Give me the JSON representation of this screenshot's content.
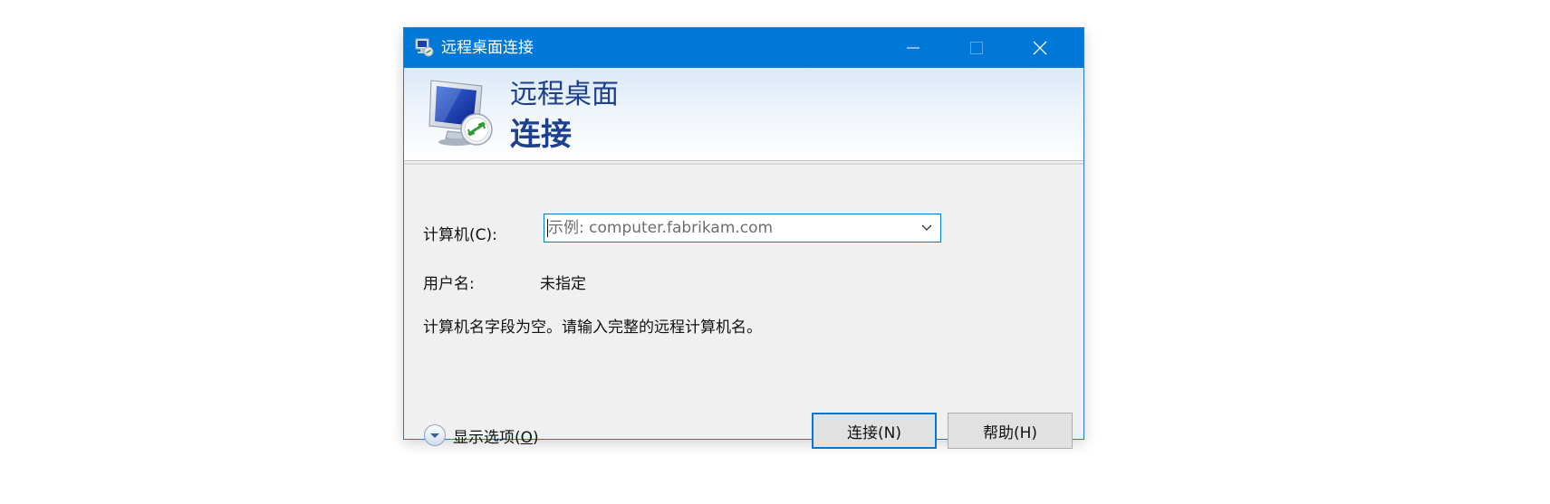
{
  "window": {
    "title": "远程桌面连接",
    "controls": [
      "minimize-icon",
      "maximize-icon",
      "close-icon"
    ]
  },
  "banner": {
    "line1": "远程桌面",
    "line2": "连接"
  },
  "form": {
    "computer_label": "计算机(C):",
    "computer_value": "",
    "computer_placeholder": "示例: computer.fabrikam.com",
    "username_label": "用户名:",
    "username_value": "未指定",
    "message": "计算机名字段为空。请输入完整的远程计算机名。"
  },
  "options": {
    "label_prefix": "显示选项(",
    "mnemonic": "O",
    "label_suffix": ")"
  },
  "buttons": {
    "connect": "连接(N)",
    "help": "帮助(H)"
  },
  "colors": {
    "titlebar": "#0078d7",
    "banner_text": "#1d3f8f",
    "dialog_bg": "#f0f0f0"
  }
}
